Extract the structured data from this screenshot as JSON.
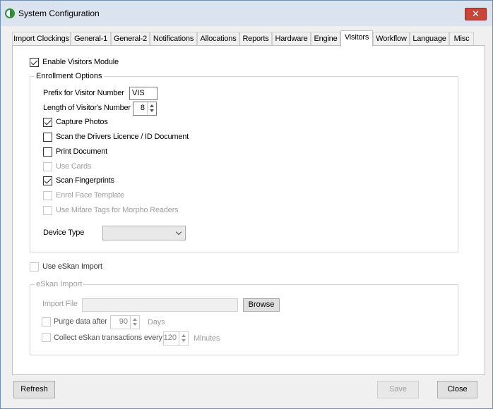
{
  "window": {
    "title": "System Configuration",
    "close_glyph": "✕"
  },
  "tabs": [
    {
      "label": "Import Clockings"
    },
    {
      "label": "General-1"
    },
    {
      "label": "General-2"
    },
    {
      "label": "Notifications"
    },
    {
      "label": "Allocations"
    },
    {
      "label": "Reports"
    },
    {
      "label": "Hardware"
    },
    {
      "label": "Engine"
    },
    {
      "label": "Visitors",
      "active": true
    },
    {
      "label": "Workflow"
    },
    {
      "label": "Language"
    },
    {
      "label": "Misc"
    }
  ],
  "visitors": {
    "enable_module": {
      "label": "Enable Visitors Module",
      "checked": true
    },
    "enrollment": {
      "title": "Enrollment Options",
      "prefix_label": "Prefix for Visitor Number",
      "prefix_value": "VIS",
      "length_label": "Length of Visitor's Number",
      "length_value": "8",
      "capture_photos": {
        "label": "Capture  Photos",
        "checked": true
      },
      "scan_licence": {
        "label": "Scan the Drivers Licence / ID Document",
        "checked": false
      },
      "print_document": {
        "label": "Print Document",
        "checked": false
      },
      "use_cards": {
        "label": "Use Cards",
        "checked": false,
        "disabled": true
      },
      "scan_fingerprints": {
        "label": "Scan Fingerprints",
        "checked": true
      },
      "enrol_face": {
        "label": "Enrol Face Template",
        "checked": false,
        "disabled": true
      },
      "use_mifare": {
        "label": "Use Mifare Tags for Morpho Readers",
        "checked": false,
        "disabled": true
      },
      "device_type_label": "Device Type",
      "device_type_value": ""
    },
    "use_eskan": {
      "label": "Use eSkan Import",
      "checked": false,
      "disabled": true
    },
    "eskan": {
      "title": "eSkan Import",
      "import_file_label": "Import File",
      "import_file_value": "",
      "browse_label": "Browse",
      "purge_label": "Purge data after",
      "purge_value": "90",
      "purge_unit": "Days",
      "collect_label": "Collect eSkan transactions every",
      "collect_value": "120",
      "collect_unit": "Minutes"
    }
  },
  "footer": {
    "refresh_label": "Refresh",
    "save_label": "Save",
    "close_label": "Close"
  }
}
